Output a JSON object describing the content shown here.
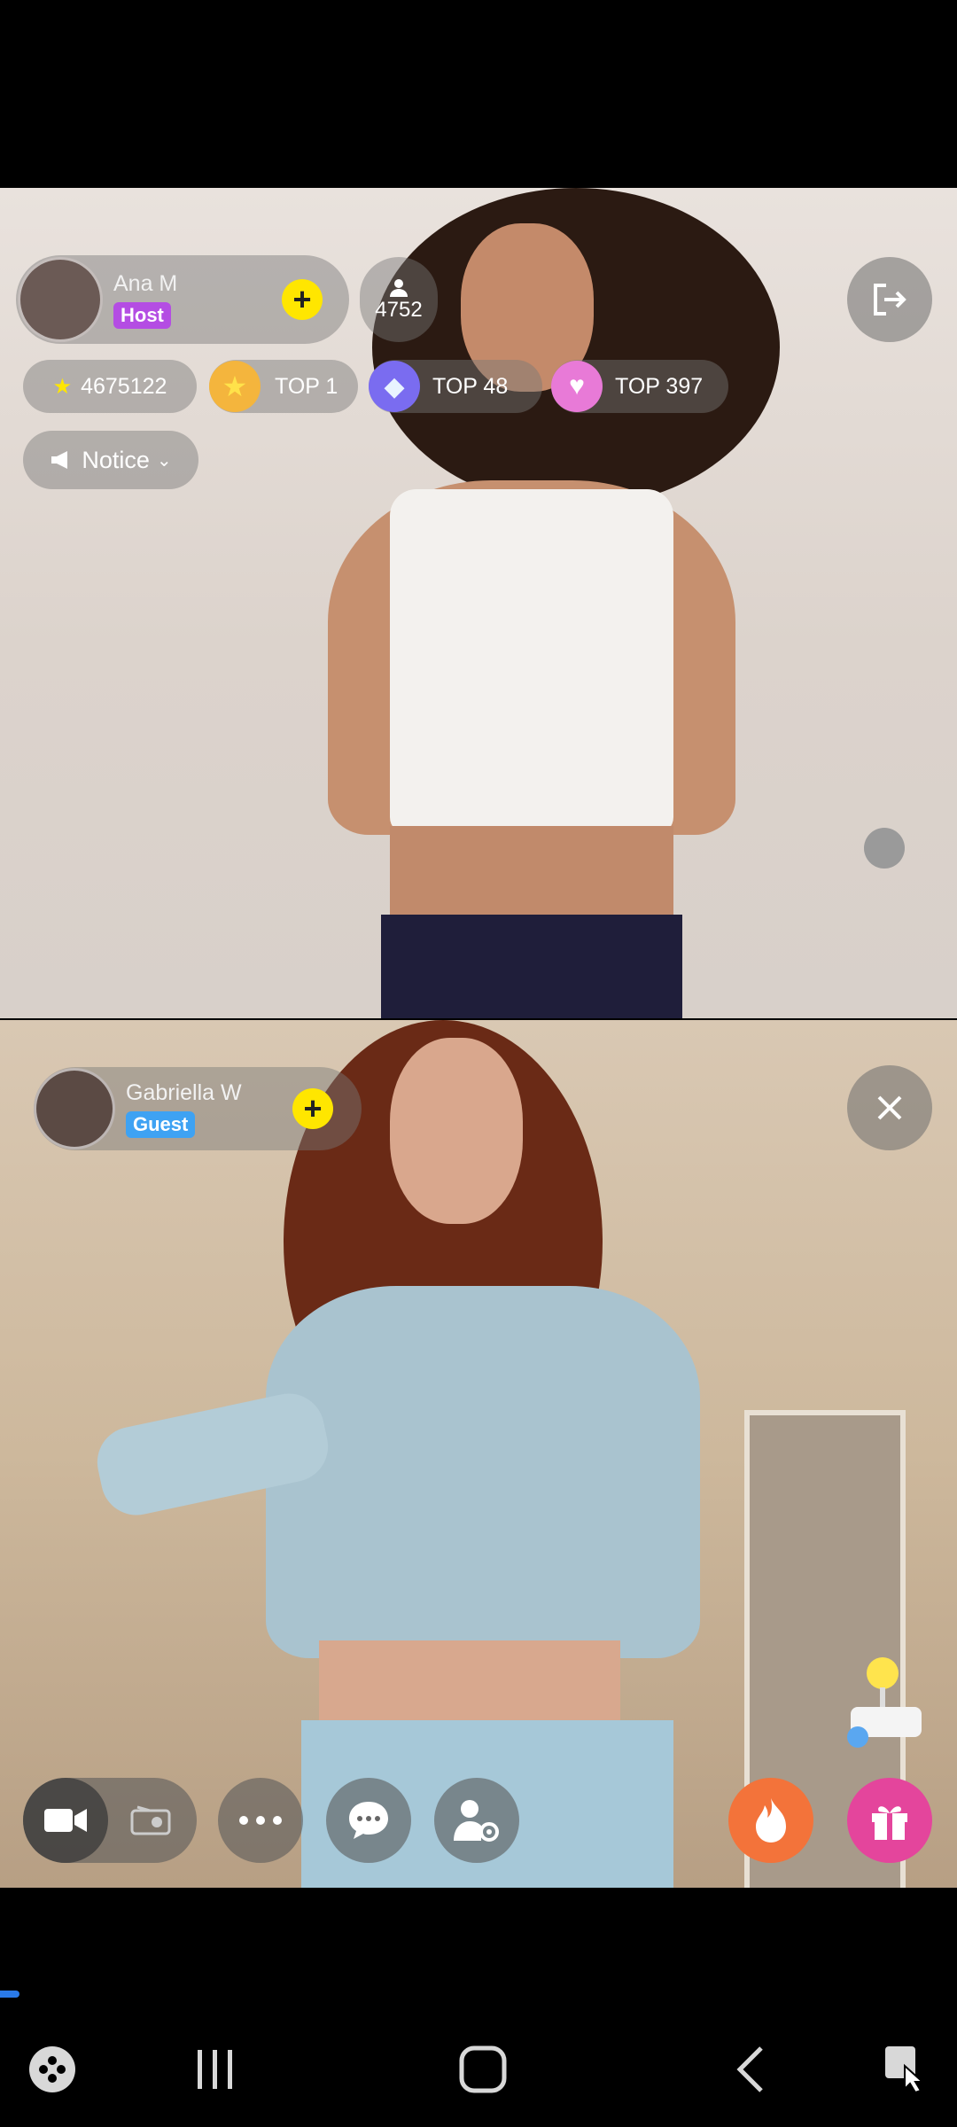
{
  "host": {
    "name": "Ana M",
    "role": "Host",
    "follow_icon": "plus",
    "viewers": "4752",
    "stars": "4675122",
    "badges": [
      {
        "icon": "star-badge",
        "label": "TOP 1",
        "color": "#f4b53d"
      },
      {
        "icon": "diamond-badge",
        "label": "TOP 48",
        "color": "#7a6cf0"
      },
      {
        "icon": "heart-badge",
        "label": "TOP 397",
        "color": "#e87ad7"
      }
    ],
    "notice_label": "Notice"
  },
  "guest": {
    "name": "Gabriella W",
    "role": "Guest",
    "follow_icon": "plus"
  },
  "controls": {
    "exit_icon": "exit-icon",
    "close_icon": "close-icon",
    "camera_icon": "video-camera-icon",
    "radio_icon": "radio-icon",
    "more_icon": "more-icon",
    "chat_icon": "chat-icon",
    "user_settings_icon": "user-settings-icon",
    "fire_icon": "fire-icon",
    "gift_icon": "gift-icon",
    "game_icon": "joystick-icon"
  },
  "colors": {
    "accent_yellow": "#ffe600",
    "host_badge": "#b44de3",
    "guest_badge": "#3ea2f3",
    "fire": "#f3733a",
    "gift": "#e4459c"
  }
}
